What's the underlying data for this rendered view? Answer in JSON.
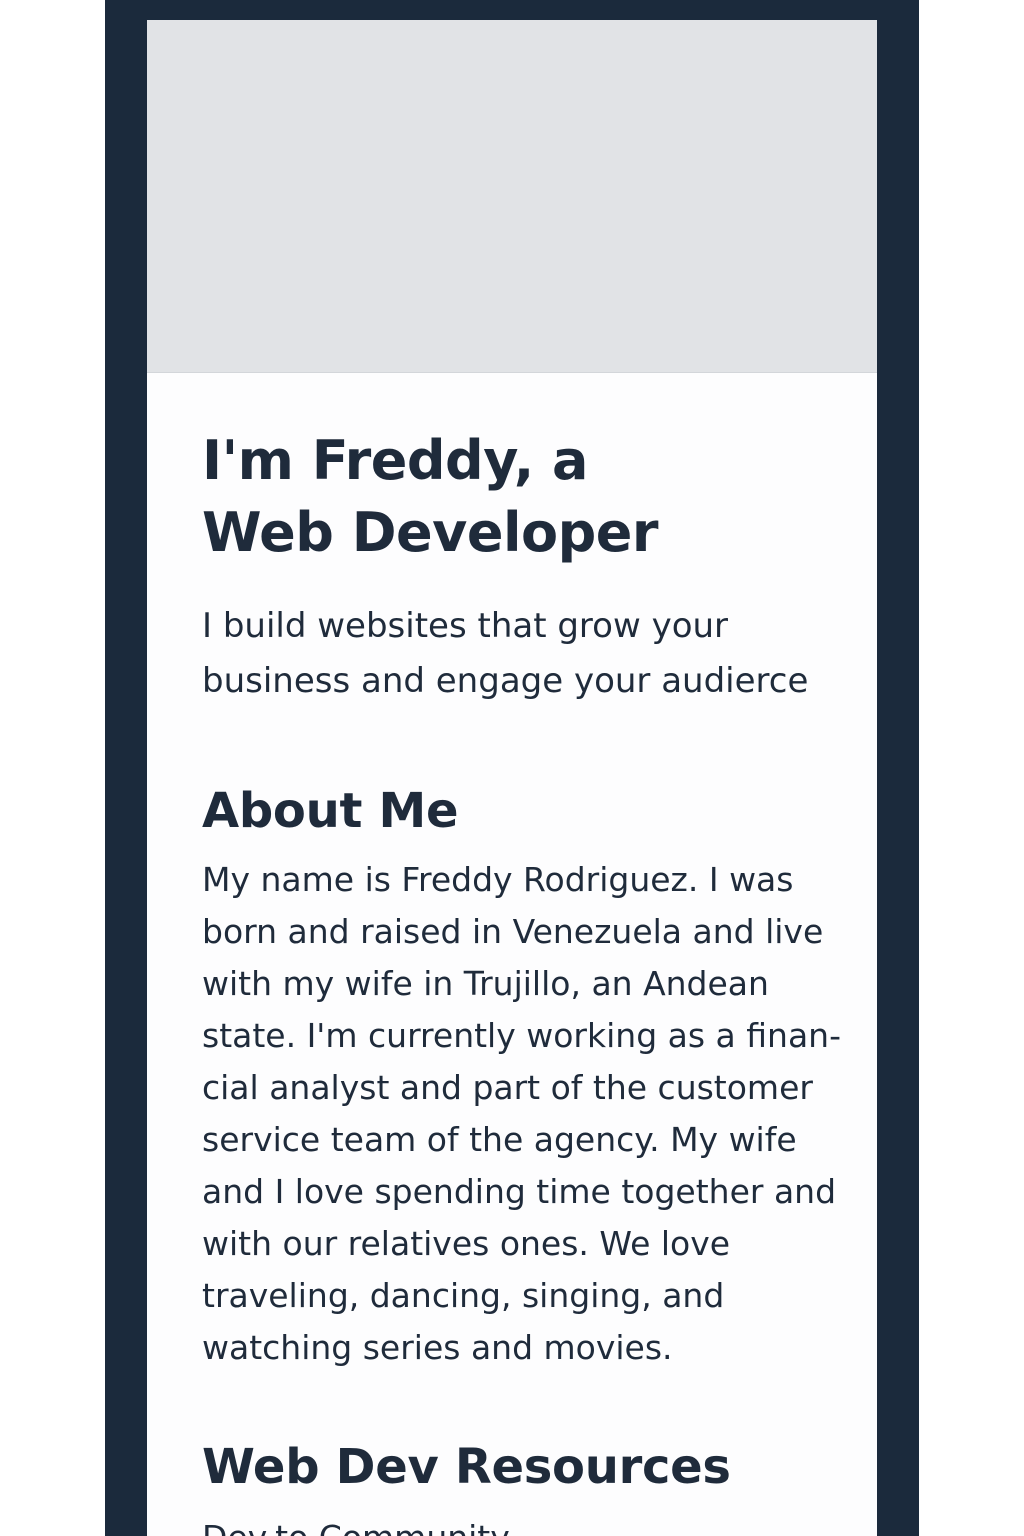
{
  "hero": {
    "title_line1": "I'm Freddy, a",
    "title_line2": "Web Developer",
    "tagline": "I build websites that grow your business and engage your audierce"
  },
  "about": {
    "heading": "About Me",
    "body": "My name is Freddy Rodriguez. I was born and raised in Venezuela and live with my wife in Trujillo, an Andean state. I'm currently working as a finan-cial analyst and part of the customer service team of the agency. My wife and I love spending time together and with our relatives ones. We love traveling, dancing, singing, and watching series and movies."
  },
  "resources": {
    "heading": "Web Dev Resources",
    "items": [
      {
        "label": "Dev.to Community"
      }
    ]
  },
  "colors": {
    "frame": "#1b2a3c",
    "text": "#1f2b3b",
    "hero_placeholder": "#e1e3e6",
    "card_background": "#fdfdfe"
  }
}
